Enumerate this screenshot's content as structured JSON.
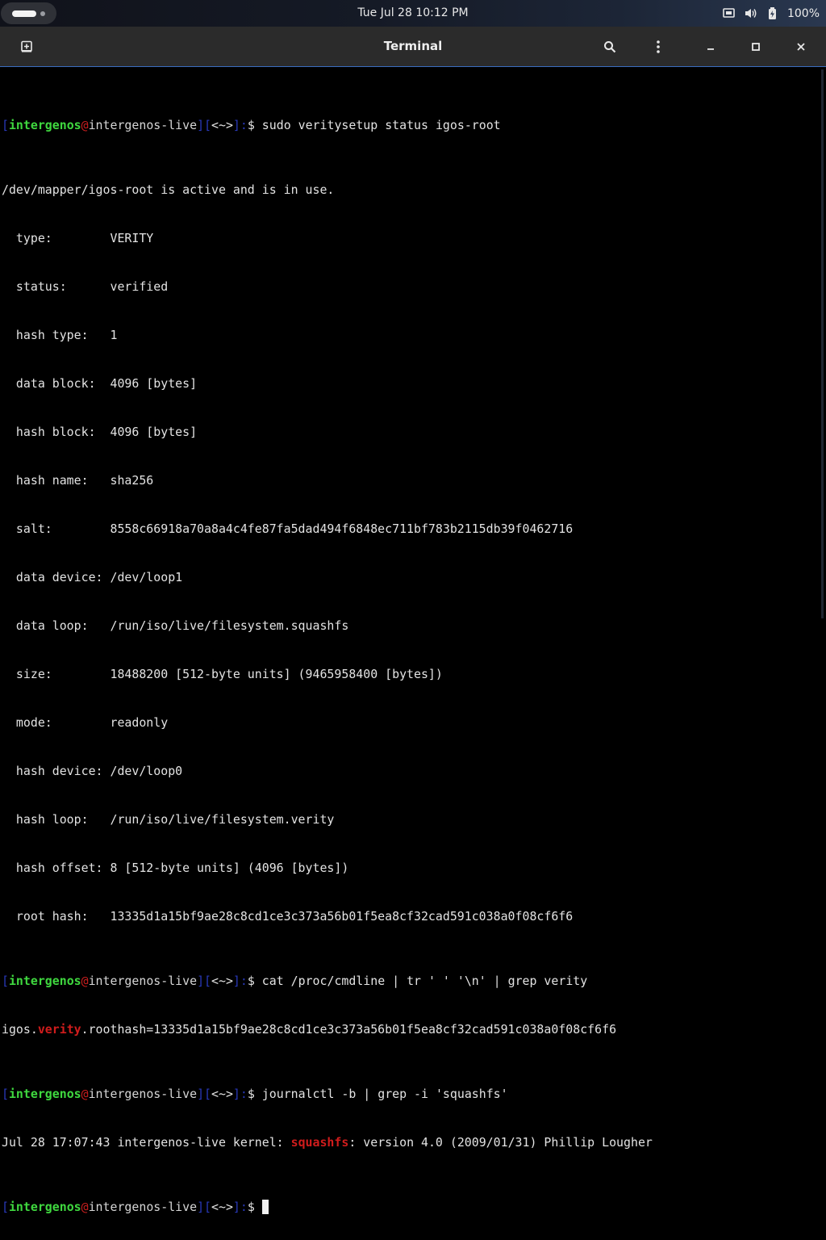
{
  "topbar": {
    "clock": "Tue Jul 28  10:12 PM",
    "battery_percent": "100%"
  },
  "window": {
    "title": "Terminal"
  },
  "icons": {
    "new_tab": "new-tab-icon",
    "search": "search-icon",
    "menu": "kebab-menu-icon",
    "minimize": "minimize-icon",
    "maximize": "maximize-icon",
    "close": "close-icon",
    "screen": "display-icon",
    "volume": "volume-icon",
    "battery": "battery-icon"
  },
  "colors": {
    "prompt_user": "#3fd83f",
    "prompt_bracket": "#2838b8",
    "prompt_at": "#c81e1e",
    "match_highlight": "#d01c1c",
    "header_accent": "#3a6dc0"
  },
  "prompt": {
    "bracket_open": "[",
    "user": "intergenos",
    "at": "@",
    "host": "intergenos-live",
    "bracket_close": "]",
    "dir_open": "[",
    "dir": "<~>",
    "dir_close": "]",
    "colon": ":",
    "dollar": "$ "
  },
  "session": {
    "cmd1": "sudo veritysetup status igos-root",
    "out1": [
      "/dev/mapper/igos-root is active and is in use.",
      "  type:        VERITY",
      "  status:      verified",
      "  hash type:   1",
      "  data block:  4096 [bytes]",
      "  hash block:  4096 [bytes]",
      "  hash name:   sha256",
      "  salt:        8558c66918a70a8a4c4fe87fa5dad494f6848ec711bf783b2115db39f0462716",
      "  data device: /dev/loop1",
      "  data loop:   /run/iso/live/filesystem.squashfs",
      "  size:        18488200 [512-byte units] (9465958400 [bytes])",
      "  mode:        readonly",
      "  hash device: /dev/loop0",
      "  hash loop:   /run/iso/live/filesystem.verity",
      "  hash offset: 8 [512-byte units] (4096 [bytes])",
      "  root hash:   13335d1a15bf9ae28c8cd1ce3c373a56b01f5ea8cf32cad591c038a0f08cf6f6"
    ],
    "cmd2": "cat /proc/cmdline | tr ' ' '\\n' | grep verity",
    "out2_pre": "igos.",
    "out2_match": "verity",
    "out2_post": ".roothash=13335d1a15bf9ae28c8cd1ce3c373a56b01f5ea8cf32cad591c038a0f08cf6f6",
    "cmd3": "journalctl -b | grep -i 'squashfs'",
    "out3_pre": "Jul 28 17:07:43 intergenos-live kernel: ",
    "out3_match": "squashfs",
    "out3_post": ": version 4.0 (2009/01/31) Phillip Lougher"
  }
}
